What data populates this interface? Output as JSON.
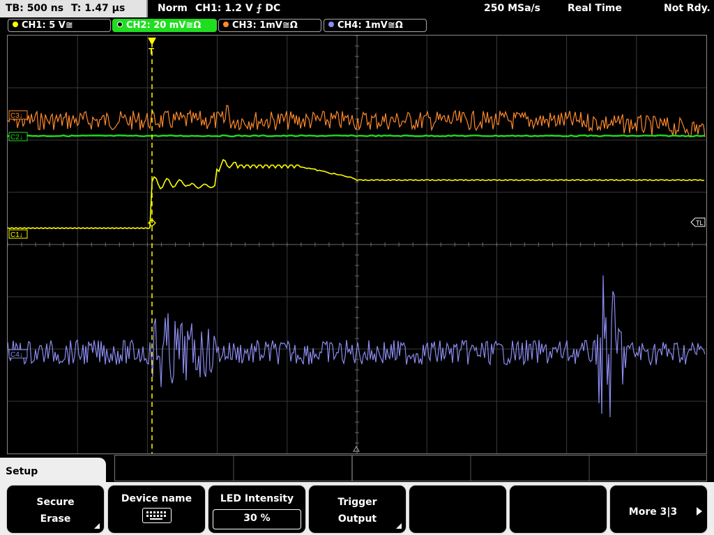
{
  "header": {
    "timebase": "TB: 500 ns",
    "trigger_time": "T: 1.47 µs",
    "trigger_mode": "Norm",
    "trigger_level": "CH1: 1.2 V ⨍ DC",
    "sample_rate": "250 MSa/s",
    "acq_mode": "Real Time",
    "status": "Not Rdy."
  },
  "channels": [
    {
      "label": "CH1: 5 V≅",
      "color": "#ffff00",
      "active": false
    },
    {
      "label": "CH2: 20 mV≅Ω",
      "color": "#20dd20",
      "active": true
    },
    {
      "label": "CH3: 1mV≅Ω",
      "color": "#ff8a2a",
      "active": false
    },
    {
      "label": "CH4: 1mV≅Ω",
      "color": "#8c8cf2",
      "active": false
    }
  ],
  "markers": {
    "c1": "C1↓",
    "c2": "C2↓",
    "c3": "C3↓",
    "c4": "C4↓",
    "trigger_level": "TL"
  },
  "menu": {
    "title": "Setup",
    "softkeys": [
      {
        "line1": "Secure",
        "line2": "Erase",
        "has_submenu": true
      },
      {
        "line1": "Device name",
        "icon": "keyboard-icon"
      },
      {
        "line1": "LED Intensity",
        "value": "30 %"
      },
      {
        "line1": "Trigger",
        "line2": "Output",
        "has_submenu": true
      },
      {
        "line1": ""
      },
      {
        "line1": ""
      },
      {
        "line1": "More 3|3",
        "icon": "arrow-right-icon"
      }
    ]
  }
}
